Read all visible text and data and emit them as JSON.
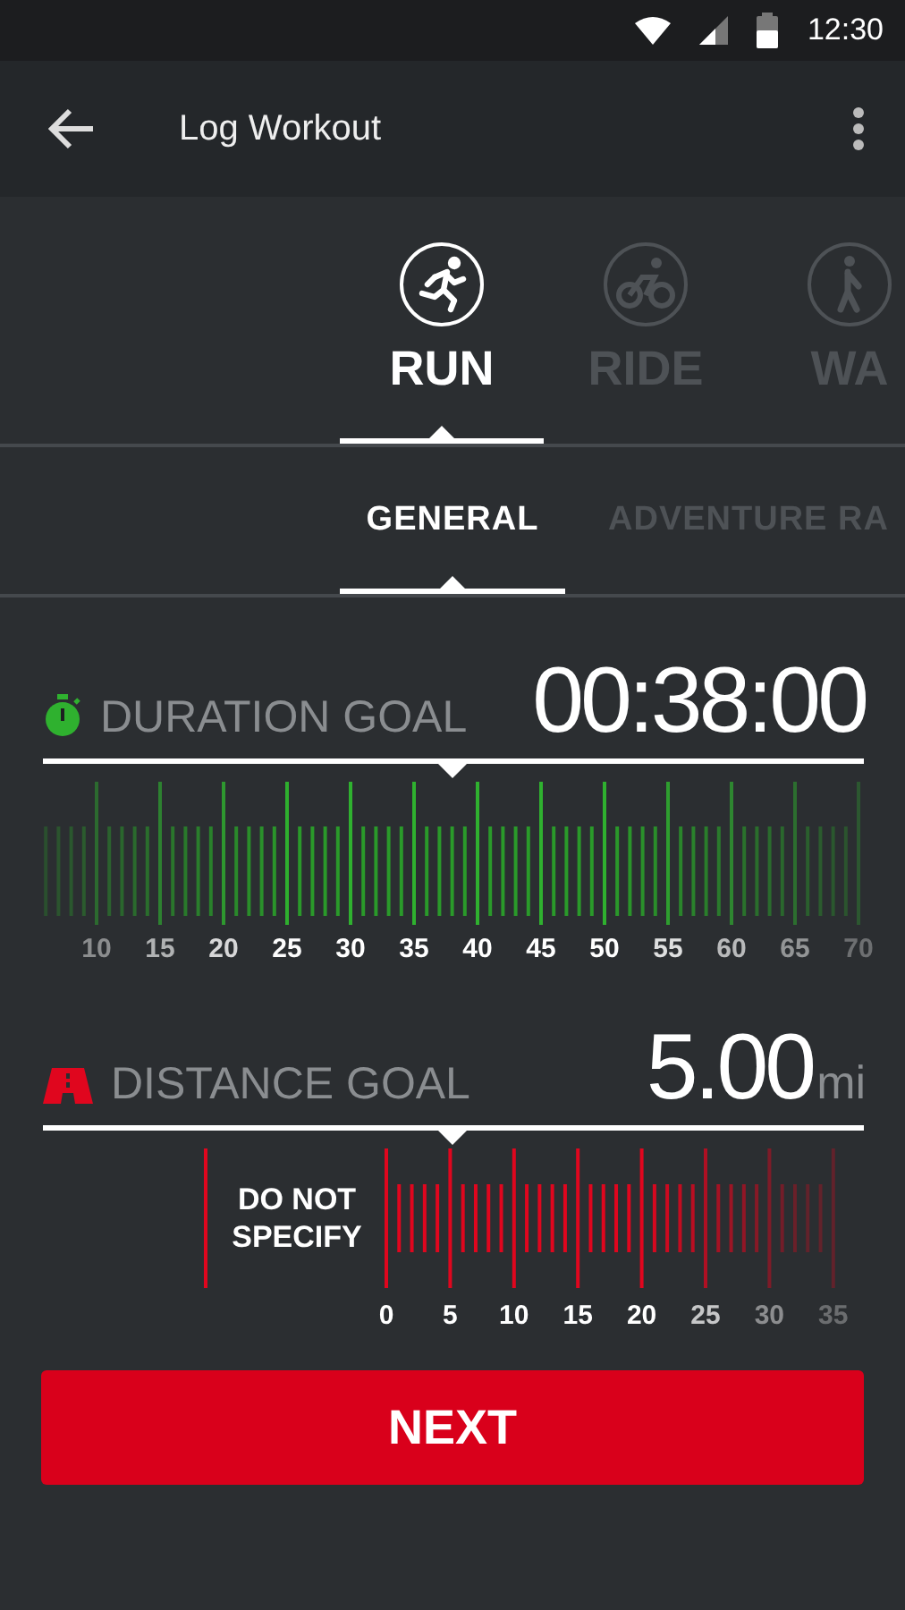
{
  "status_bar": {
    "time": "12:30"
  },
  "app_bar": {
    "title": "Log Workout"
  },
  "activity_tabs": [
    {
      "label": "RUN",
      "selected": true,
      "kind": "run"
    },
    {
      "label": "RIDE",
      "selected": false,
      "kind": "ride"
    },
    {
      "label": "WA",
      "selected": false,
      "kind": "walk"
    }
  ],
  "sub_tabs": [
    {
      "label": "GENERAL",
      "selected": true
    },
    {
      "label": "ADVENTURE RA",
      "selected": false
    }
  ],
  "duration_goal": {
    "label": "DURATION GOAL",
    "value": "00:38:00",
    "scale_labels": [
      "10",
      "15",
      "20",
      "25",
      "30",
      "35",
      "40",
      "45",
      "50",
      "55",
      "60",
      "65",
      "70"
    ]
  },
  "distance_goal": {
    "label": "DISTANCE GOAL",
    "value": "5.00",
    "unit": "mi",
    "none_option": "DO NOT SPECIFY",
    "scale_labels": [
      "0",
      "5",
      "10",
      "15",
      "20",
      "25",
      "30",
      "35"
    ]
  },
  "next_button": "NEXT"
}
